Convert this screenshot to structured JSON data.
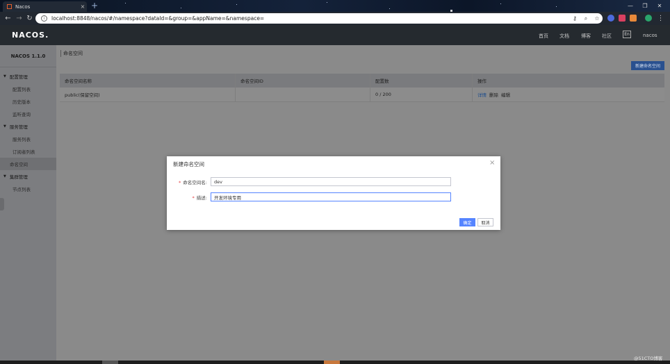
{
  "browser": {
    "tab_title": "Nacos",
    "tab_close": "×",
    "new_tab": "+",
    "url": "localhost:8848/nacos/#/namespace?dataId=&group=&appName=&namespace=",
    "window_controls": [
      "—",
      "❐",
      "✕"
    ],
    "nav_icons": [
      "arrow-left-icon",
      "arrow-right-icon",
      "reload-icon"
    ],
    "colors": {
      "tabbar": "#14223a",
      "toolbar": "#222831"
    }
  },
  "header": {
    "logo": "NACOS.",
    "nav": [
      "首页",
      "文档",
      "博客",
      "社区"
    ],
    "lang": "En",
    "user": "nacos"
  },
  "sidebar": {
    "version": "NACOS 1.1.0",
    "groups": [
      {
        "label": "配置管理",
        "items": [
          "配置列表",
          "历史版本",
          "监听查询"
        ]
      },
      {
        "label": "服务管理",
        "items": [
          "服务列表",
          "订阅者列表"
        ]
      },
      {
        "label": "命名空间",
        "items": []
      },
      {
        "label": "集群管理",
        "items": [
          "节点列表"
        ]
      }
    ],
    "active_item": "命名空间"
  },
  "main": {
    "page_title": "命名空间",
    "create_button": "新建命名空间",
    "table": {
      "columns": [
        "命名空间名称",
        "命名空间ID",
        "配置数",
        "操作"
      ],
      "rows": [
        {
          "name": "public(保留空间)",
          "id": "",
          "count": "0 / 200",
          "ops": [
            "详情",
            "删除",
            "编辑"
          ]
        }
      ]
    }
  },
  "dialog": {
    "title": "新建命名空间",
    "close": "×",
    "fields": [
      {
        "label": "命名空间名:",
        "value": "dev",
        "required": true
      },
      {
        "label": "描述:",
        "value": "开发环境专用",
        "required": true,
        "focused": true
      }
    ],
    "ok": "确定",
    "cancel": "取消",
    "accent": "#5584ff"
  },
  "watermark": "@51CTO博客"
}
